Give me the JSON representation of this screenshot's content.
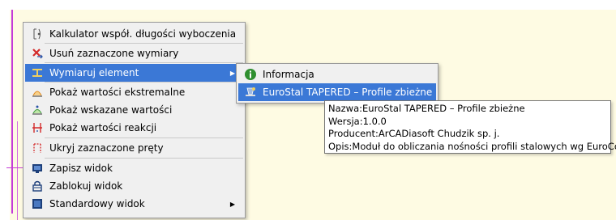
{
  "context_menu": {
    "items": [
      {
        "label": "Kalkulator współ. długości wyboczenia",
        "icon": "buckling-length-icon"
      },
      {
        "label": "Usuń zaznaczone wymiary",
        "icon": "delete-dimension-icon"
      },
      {
        "label": "Wymiaruj element",
        "icon": "dimension-element-icon",
        "has_submenu": true,
        "highlighted": true
      },
      {
        "label": "Pokaż wartości ekstremalne",
        "icon": "extreme-values-icon"
      },
      {
        "label": "Pokaż wskazane wartości",
        "icon": "selected-values-icon"
      },
      {
        "label": "Pokaż wartości reakcji",
        "icon": "reaction-values-icon"
      },
      {
        "label": "Ukryj zaznaczone pręty",
        "icon": "hide-bars-icon"
      },
      {
        "label": "Zapisz widok",
        "icon": "save-view-icon"
      },
      {
        "label": "Zablokuj widok",
        "icon": "lock-view-icon"
      },
      {
        "label": "Standardowy widok",
        "icon": "standard-view-icon",
        "has_submenu": true
      }
    ],
    "submenu_arrow": "▶"
  },
  "submenu": {
    "items": [
      {
        "label": "Informacja",
        "icon": "info-icon"
      },
      {
        "label": "EuroStal TAPERED – Profile zbieżne",
        "icon": "eurostal-icon",
        "highlighted": true
      }
    ]
  },
  "tooltip": {
    "name_label": "Nazwa:",
    "name_value": "EuroStal TAPERED – Profile zbieżne",
    "version_label": "Wersja:",
    "version_value": "1.0.0",
    "producer_label": "Producent:",
    "producer_value": "ArCADiasoft Chudzik sp. j.",
    "desc_label": "Opis:",
    "desc_value": "Moduł do obliczania nośności profili stalowych wg EuroCode"
  },
  "colors": {
    "highlight": "#3b78d6",
    "canvas": "#fefbe3",
    "guide_line": "#c43bd8",
    "info_green": "#2f8f2f"
  }
}
